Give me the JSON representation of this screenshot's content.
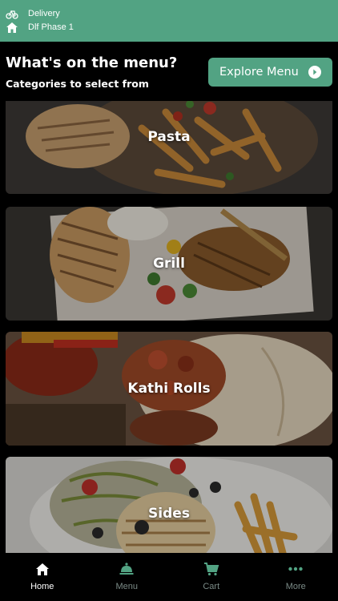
{
  "status": {
    "mode_label": "Delivery",
    "location_label": "Dlf Phase 1"
  },
  "header": {
    "title": "What's on the menu?",
    "subtitle": "Categories to select from",
    "explore_label": "Explore Menu"
  },
  "categories": [
    {
      "label": "Pasta"
    },
    {
      "label": "Grill"
    },
    {
      "label": "Kathi Rolls"
    },
    {
      "label": "Sides"
    }
  ],
  "nav": {
    "items": [
      {
        "label": "Home",
        "icon": "home-icon",
        "active": true
      },
      {
        "label": "Menu",
        "icon": "cloche-icon",
        "active": false
      },
      {
        "label": "Cart",
        "icon": "cart-icon",
        "active": false
      },
      {
        "label": "More",
        "icon": "more-dots-icon",
        "active": false
      }
    ]
  },
  "colors": {
    "accent": "#52a383",
    "background": "#000000",
    "nav_inactive": "#7a8a86"
  }
}
